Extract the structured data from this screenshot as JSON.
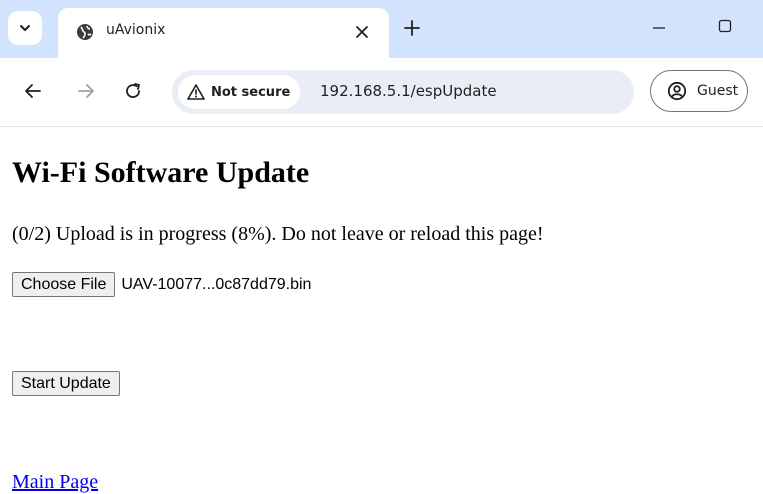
{
  "browser": {
    "tab": {
      "title": "uAvionix",
      "favicon": "globe-icon"
    },
    "security_label": "Not secure",
    "url": "192.168.5.1/espUpdate",
    "profile_label": "Guest"
  },
  "page": {
    "heading": "Wi-Fi Software Update",
    "status": "(0/2) Upload is in progress (8%). Do not leave or reload this page!",
    "choose_file_label": "Choose File",
    "file_name": "UAV-10077...0c87dd79.bin",
    "start_update_label": "Start Update",
    "main_page_link": "Main Page"
  },
  "colors": {
    "tabstrip": "#d3e3fd",
    "omnibox": "#e9eef6",
    "link": "#0000ee"
  }
}
